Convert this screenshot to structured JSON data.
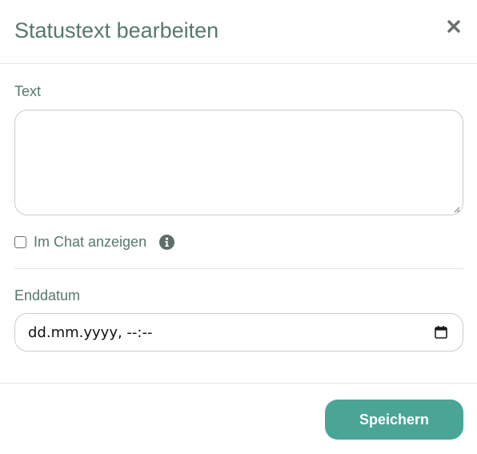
{
  "modal": {
    "title": "Statustext bearbeiten",
    "close_icon": "close-icon"
  },
  "text_field": {
    "label": "Text",
    "value": "",
    "placeholder": ""
  },
  "show_in_chat": {
    "label": "Im Chat anzeigen",
    "checked": false,
    "info_icon": "info-icon"
  },
  "end_date": {
    "label": "Enddatum",
    "value": "dd.mm.yyyy, --:--",
    "calendar_icon": "calendar-icon"
  },
  "footer": {
    "save_label": "Speichern"
  },
  "colors": {
    "title": "#56786f",
    "accent": "#4aa597",
    "border": "#c9cfcd",
    "divider": "#e3e6e5"
  }
}
